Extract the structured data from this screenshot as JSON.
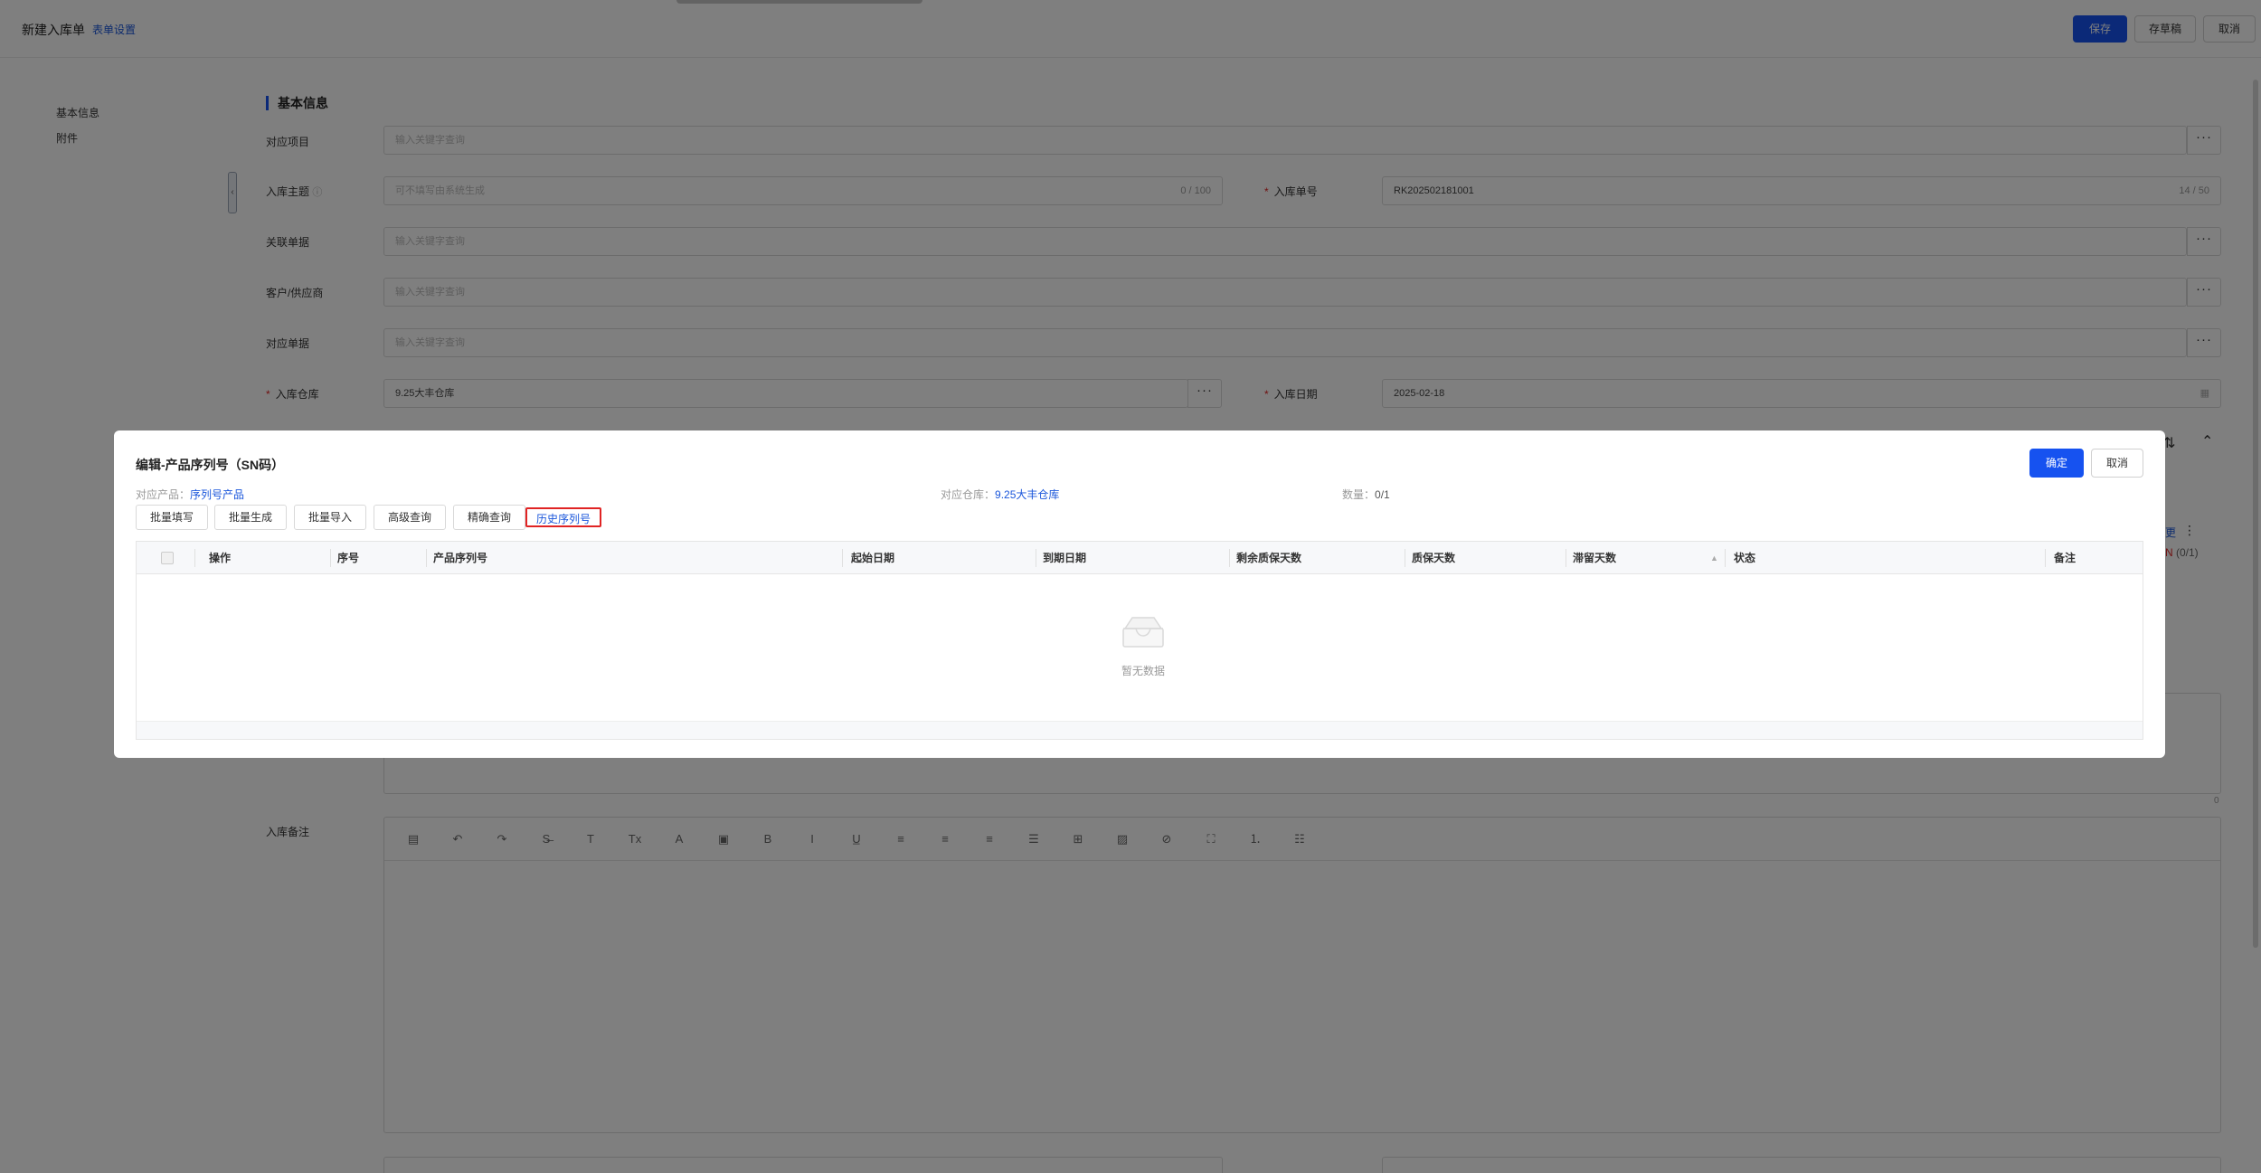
{
  "page": {
    "title": "新建入库单",
    "form_settings_link": "表单设置",
    "save_label": "保存",
    "draft_label": "存草稿",
    "cancel_label": "取消"
  },
  "sidenav": {
    "items": [
      {
        "label": "基本信息"
      },
      {
        "label": "附件"
      }
    ]
  },
  "form": {
    "section_title": "基本信息",
    "project": {
      "label": "对应项目",
      "placeholder": "输入关键字查询"
    },
    "subject": {
      "label": "入库主题",
      "placeholder": "可不填写由系统生成",
      "count": "0 / 100"
    },
    "order_no": {
      "label": "入库单号",
      "value": "RK202502181001",
      "count": "14 / 50"
    },
    "related_doc": {
      "label": "关联单据",
      "placeholder": "输入关键字查询"
    },
    "partner": {
      "label": "客户/供应商",
      "placeholder": "输入关键字查询"
    },
    "counter_doc": {
      "label": "对应单据",
      "placeholder": "输入关键字查询"
    },
    "warehouse": {
      "label": "入库仓库",
      "value": "9.25大丰仓库"
    },
    "date": {
      "label": "入库日期",
      "value": "2025-02-18"
    },
    "remark_label": "入库备注",
    "textarea_count": "0",
    "peek_right_text": "(0/1)",
    "peek_link_text": "更"
  },
  "editor_tools": [
    "format-icon",
    "undo-icon",
    "redo-icon",
    "strikethrough-icon",
    "text-icon",
    "clear-format-icon",
    "font-color-icon",
    "bg-color-icon",
    "bold-icon",
    "italic-icon",
    "underline-icon",
    "align-left-icon",
    "align-center-icon",
    "align-right-icon",
    "justify-icon",
    "table-icon",
    "image-icon",
    "attachment-icon",
    "fullscreen-icon",
    "ordered-list-icon",
    "bullet-list-icon"
  ],
  "modal": {
    "title": "编辑-产品序列号（SN码）",
    "confirm_label": "确定",
    "cancel_label": "取消",
    "product_label": "对应产品：",
    "product_value": "序列号产品",
    "warehouse_label": "对应仓库：",
    "warehouse_value": "9.25大丰仓库",
    "qty_label": "数量：",
    "qty_value": "0/1",
    "toolbar": {
      "batch_fill": "批量填写",
      "batch_generate": "批量生成",
      "batch_import": "批量导入",
      "advanced_query": "高级查询",
      "exact_query": "精确查询",
      "history_sn": "历史序列号"
    },
    "columns": [
      "操作",
      "序号",
      "产品序列号",
      "起始日期",
      "到期日期",
      "剩余质保天数",
      "质保天数",
      "滞留天数",
      "状态",
      "备注"
    ],
    "empty_text": "暂无数据"
  }
}
